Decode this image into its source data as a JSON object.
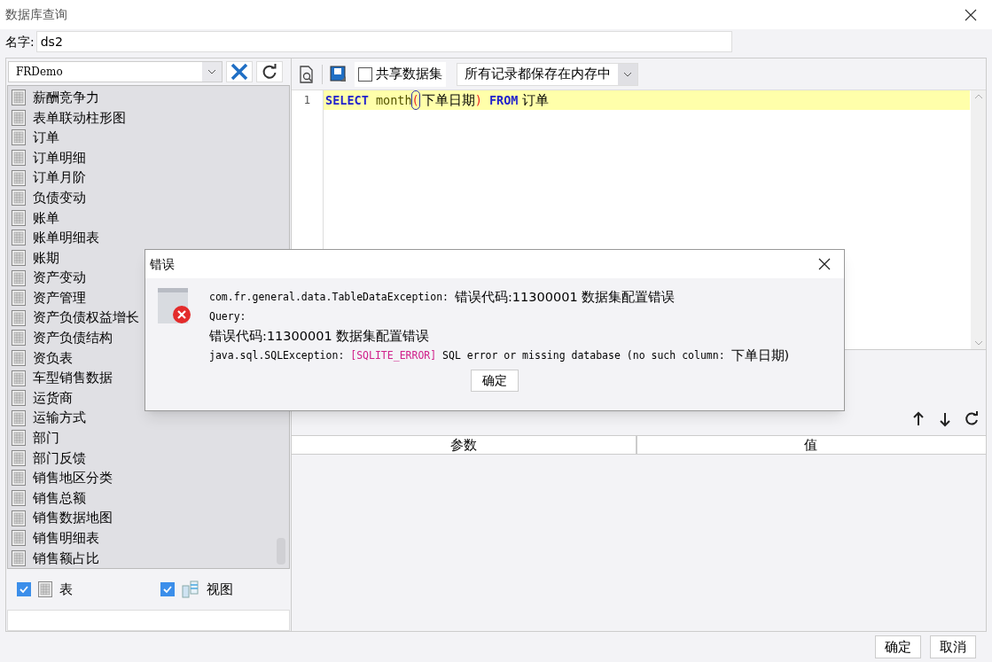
{
  "window": {
    "title": "数据库查询"
  },
  "name_field": {
    "label": "名字:",
    "value": "ds2"
  },
  "connection": {
    "value": "FRDemo"
  },
  "tables": [
    {
      "label": "薪酬竞争力"
    },
    {
      "label": "表单联动柱形图"
    },
    {
      "label": "订单"
    },
    {
      "label": "订单明细"
    },
    {
      "label": "订单月阶"
    },
    {
      "label": "负债变动"
    },
    {
      "label": "账单"
    },
    {
      "label": "账单明细表"
    },
    {
      "label": "账期"
    },
    {
      "label": "资产变动"
    },
    {
      "label": "资产管理"
    },
    {
      "label": "资产负债权益增长"
    },
    {
      "label": "资产负债结构"
    },
    {
      "label": "资负表"
    },
    {
      "label": "车型销售数据"
    },
    {
      "label": "运货商"
    },
    {
      "label": "运输方式"
    },
    {
      "label": "部门"
    },
    {
      "label": "部门反馈"
    },
    {
      "label": "销售地区分类"
    },
    {
      "label": "销售总额"
    },
    {
      "label": "销售数据地图"
    },
    {
      "label": "销售明细表"
    },
    {
      "label": "销售额占比"
    }
  ],
  "filters": [
    {
      "label": "表",
      "checked": true,
      "kind": "table"
    },
    {
      "label": "视图",
      "checked": true,
      "kind": "view"
    }
  ],
  "toolbar": {
    "share_checkbox": {
      "label": "共享数据集",
      "checked": false
    },
    "cache_select": {
      "value": "所有记录都保存在内存中"
    }
  },
  "editor": {
    "lines": [
      {
        "number": "1",
        "tokens": [
          {
            "text": "SELECT",
            "kind": "keyword"
          },
          {
            "text": " month",
            "kind": "function"
          },
          {
            "text": "(",
            "kind": "bracket-match"
          },
          {
            "text": "下单日期",
            "kind": "plain"
          },
          {
            "text": ")",
            "kind": "bracket"
          },
          {
            "text": " FROM",
            "kind": "keyword"
          },
          {
            "text": " 订单",
            "kind": "plain"
          }
        ]
      }
    ]
  },
  "params_table": {
    "columns": [
      "参数",
      "值"
    ]
  },
  "dialog": {
    "title": "错误",
    "lines": [
      [
        {
          "text": "com.fr.general.data.TableDataException: ",
          "kind": "mono"
        },
        {
          "text": "错误代码:11300001 数据集配置错误",
          "kind": "text"
        }
      ],
      [
        {
          "text": "Query:",
          "kind": "mono"
        }
      ],
      [
        {
          "text": "错误代码:11300001 数据集配置错误",
          "kind": "text"
        }
      ],
      [
        {
          "text": "java.sql.SQLException: ",
          "kind": "mono"
        },
        {
          "text": "[SQLITE_ERROR]",
          "kind": "error"
        },
        {
          "text": " SQL error or missing database (no such column: ",
          "kind": "mono"
        },
        {
          "text": "下单日期)",
          "kind": "text"
        }
      ]
    ],
    "button": "确定"
  },
  "buttons": [
    {
      "label": "确定"
    },
    {
      "label": "取消"
    }
  ]
}
